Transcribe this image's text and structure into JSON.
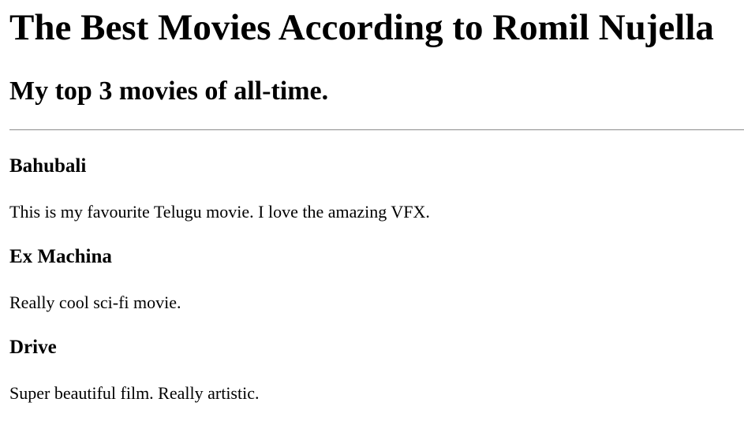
{
  "page": {
    "title": "The Best Movies According to Romil Nujella",
    "subtitle": "My top 3 movies of all-time."
  },
  "movies": [
    {
      "title": "Bahubali",
      "description": "This is my favourite Telugu movie. I love the amazing VFX."
    },
    {
      "title": "Ex Machina",
      "description": "Really cool sci-fi movie."
    },
    {
      "title": "Drive",
      "description": "Super beautiful film. Really artistic."
    }
  ]
}
